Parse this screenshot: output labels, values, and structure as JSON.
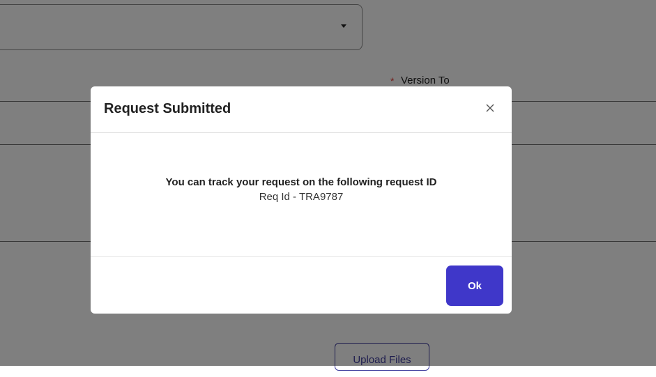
{
  "background": {
    "version_to_label": "Version To",
    "required_marker": "*",
    "upload_button_label": "Upload Files"
  },
  "modal": {
    "title": "Request Submitted",
    "message": "You can track your request on the following request ID",
    "request_id_text": "Req Id - TRA9787",
    "ok_label": "Ok"
  },
  "colors": {
    "primary_button": "#3f37c9",
    "overlay": "rgba(0,0,0,0.5)"
  },
  "icons": {
    "close": "close-icon",
    "dropdown": "chevron-down-icon"
  }
}
